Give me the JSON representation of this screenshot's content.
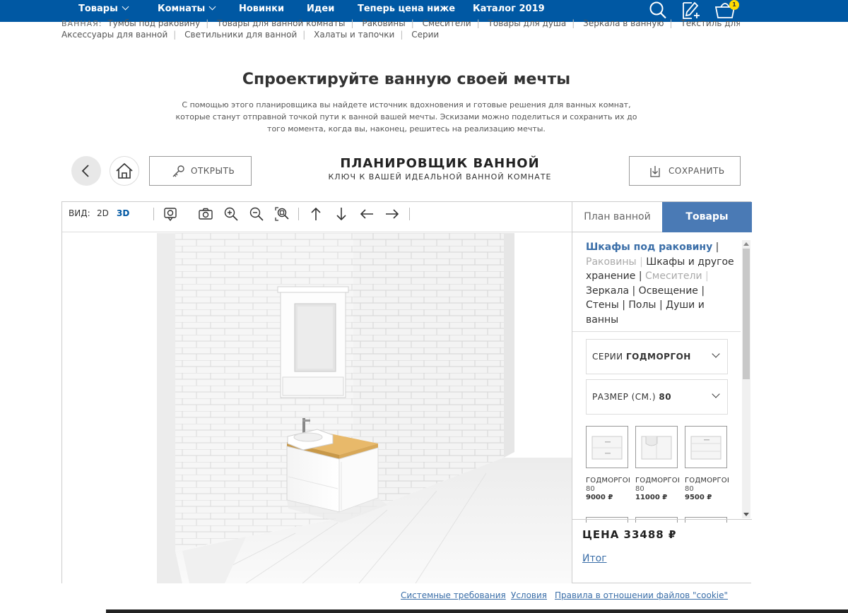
{
  "nav": {
    "items": [
      {
        "label": "Товары",
        "has_dropdown": true
      },
      {
        "label": "Комнаты",
        "has_dropdown": true
      },
      {
        "label": "Новинки",
        "has_dropdown": false
      },
      {
        "label": "Идеи",
        "has_dropdown": false
      },
      {
        "label": "Теперь цена ниже",
        "has_dropdown": false
      },
      {
        "label": "Каталог 2019",
        "has_dropdown": false
      }
    ],
    "icons": [
      "search-icon",
      "shopping-list-icon",
      "cart-icon"
    ],
    "cart_count": "1",
    "background": "#0058a3"
  },
  "sublinks": {
    "label": "ВАННАЯ:",
    "row1": [
      "Тумбы под раковину",
      "Товары для ванной комнаты",
      "Раковины",
      "Смесители",
      "Товары для душа",
      "Зеркала в ванную",
      "Текстиль для ванной"
    ],
    "row2": [
      "Аксессуары для ванной",
      "Светильники для ванной",
      "Халаты и тапочки",
      "Серии"
    ]
  },
  "hero": {
    "title": "Спроектируйте ванную своей мечты",
    "desc_line1": "С помощью этого планировщика вы найдете источник вдохновения и готовые решения для ванных комнат,",
    "desc_line2": "которые станут отправной точкой пути к ванной вашей мечты. Эскизами можно поделиться и сохранить их до",
    "desc_line3": "того момента, когда вы, наконец, решитесь на реализацию мечты."
  },
  "planner": {
    "title": "ПЛАНИРОВЩИК ВАННОЙ",
    "subtitle": "КЛЮЧ К ВАШЕЙ ИДЕАЛЬНОЙ ВАННОЙ КОМНАТЕ",
    "open_label": "ОТКРЫТЬ",
    "save_label": "СОХРАНИТЬ"
  },
  "toolbar": {
    "view_label": "ВИД:",
    "view_2d": "2D",
    "view_3d": "3D",
    "active_view": "3D",
    "tools": [
      "camera-settings-icon",
      "camera-icon",
      "zoom-in-icon",
      "zoom-out-icon",
      "zoom-fit-icon",
      "arrow-up-icon",
      "arrow-down-icon",
      "arrow-left-icon",
      "arrow-right-icon"
    ]
  },
  "panel": {
    "tab_plan": "План ванной",
    "tab_goods": "Товары",
    "active_tab": "Товары",
    "categories": [
      {
        "label": "Шкафы под раковину",
        "state": "active"
      },
      {
        "label": "Раковины",
        "state": "muted"
      },
      {
        "label": "Шкафы и другое хранение",
        "state": "normal"
      },
      {
        "label": "Смесители",
        "state": "muted"
      },
      {
        "label": "Зеркала",
        "state": "normal"
      },
      {
        "label": "Освещение",
        "state": "normal"
      },
      {
        "label": "Стены",
        "state": "normal"
      },
      {
        "label": "Полы",
        "state": "normal"
      },
      {
        "label": "Души и ванны",
        "state": "normal"
      }
    ],
    "series_label": "СЕРИИ",
    "series_value": "ГОДМОРГОН",
    "size_label": "РАЗМЕР (СМ.)",
    "size_value": "80",
    "products": [
      {
        "name": "ГОДМОРГОН",
        "size": "80",
        "price": "9000 ₽"
      },
      {
        "name": "ГОДМОРГОН",
        "size": "80",
        "price": "11000 ₽"
      },
      {
        "name": "ГОДМОРГОН",
        "size": "80",
        "price": "9500 ₽"
      }
    ],
    "price_text": "ЦЕНА 33488 ₽",
    "total_link": "Итог"
  },
  "footer": {
    "links": [
      "Системные требования",
      "Условия",
      "Правила в отношении файлов \"cookie\""
    ]
  }
}
